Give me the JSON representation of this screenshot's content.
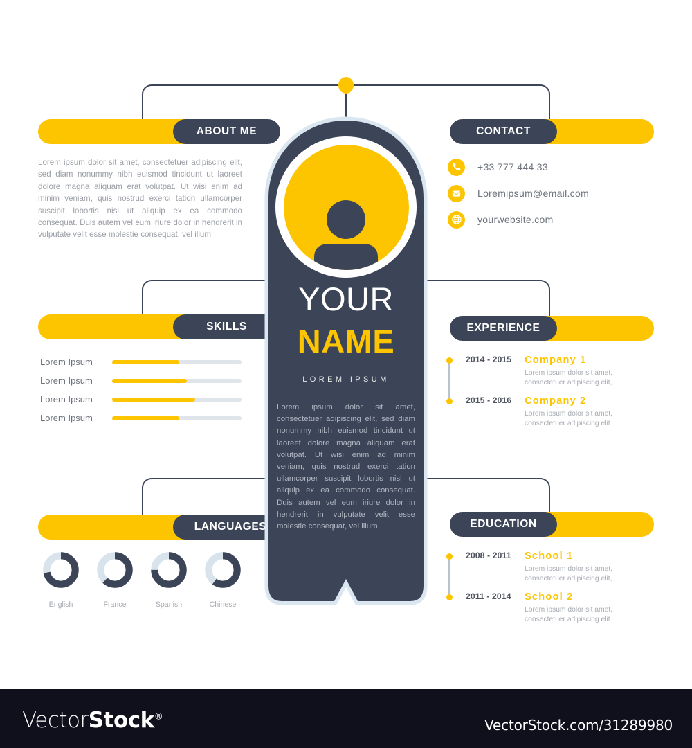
{
  "colors": {
    "yellow": "#fdc500",
    "navy": "#3c4558",
    "light_blue_gray": "#dfe5ea",
    "body_text": "#9b9fa6",
    "footer_bg": "#100f1c"
  },
  "profile": {
    "first_line": "YOUR",
    "second_line": "NAME",
    "subtitle": "LOREM IPSUM",
    "avatar_icon": "person-avatar-icon",
    "bio": "Lorem ipsum dolor sit amet, consectetuer adipiscing elit, sed diam nonummy nibh euismod tincidunt ut laoreet dolore magna aliquam erat volutpat. Ut wisi enim ad minim veniam, quis nostrud exerci tation ullamcorper suscipit lobortis nisl ut aliquip ex ea commodo consequat. Duis autem vel eum iriure dolor in hendrerit in vulputate velit esse molestie consequat, vel illum"
  },
  "about": {
    "title": "ABOUT ME",
    "text": "Lorem ipsum dolor sit amet, consectetuer adipiscing elit, sed diam nonummy nibh euismod tincidunt ut laoreet dolore magna aliquam erat volutpat. Ut wisi enim ad minim veniam, quis nostrud exerci tation ullamcorper suscipit lobortis nisl ut aliquip ex ea commodo consequat. Duis autem vel eum iriure dolor in hendrerit in vulputate velit esse molestie consequat, vel illum"
  },
  "contact": {
    "title": "CONTACT",
    "items": [
      {
        "icon": "phone-icon",
        "value": "+33 777 444 33"
      },
      {
        "icon": "envelope-icon",
        "value": "Loremipsum@email.com"
      },
      {
        "icon": "globe-icon",
        "value": "yourwebsite.com"
      }
    ]
  },
  "skills": {
    "title": "SKILLS",
    "items": [
      {
        "label": "Lorem Ipsum",
        "percent": 52
      },
      {
        "label": "Lorem Ipsum",
        "percent": 58
      },
      {
        "label": "Lorem Ipsum",
        "percent": 64
      },
      {
        "label": "Lorem Ipsum",
        "percent": 52
      }
    ]
  },
  "experience": {
    "title": "EXPERIENCE",
    "entries": [
      {
        "date": "2014 - 2015",
        "title": "Company 1",
        "desc": "Lorem ipsum dolor sit amet, consectetuer adipiscing elit,"
      },
      {
        "date": "2015 - 2016",
        "title": "Company 2",
        "desc": "Lorem ipsum dolor sit amet, consectetuer adipiscing elit"
      }
    ]
  },
  "education": {
    "title": "EDUCATION",
    "entries": [
      {
        "date": "2008 - 2011",
        "title": "School 1",
        "desc": "Lorem ipsum dolor sit amet, consectetuer adipiscing elit,"
      },
      {
        "date": "2011 - 2014",
        "title": "School 2",
        "desc": "Lorem ipsum dolor sit amet, consectetuer adipiscing elit"
      }
    ]
  },
  "languages": {
    "title": "LANGUAGES",
    "items": [
      {
        "label": "English",
        "percent": 72
      },
      {
        "label": "France",
        "percent": 62
      },
      {
        "label": "Spanish",
        "percent": 75
      },
      {
        "label": "Chinese",
        "percent": 60
      }
    ]
  },
  "footer": {
    "logo_light": "Vector",
    "logo_bold": "Stock",
    "logo_mark": "®",
    "url": "VectorStock.com/31289980"
  },
  "chart_data": [
    {
      "type": "bar",
      "title": "SKILLS",
      "orientation": "horizontal",
      "categories": [
        "Lorem Ipsum",
        "Lorem Ipsum",
        "Lorem Ipsum",
        "Lorem Ipsum"
      ],
      "values": [
        52,
        58,
        64,
        52
      ],
      "xlabel": "",
      "ylabel": "",
      "ylim": [
        0,
        100
      ],
      "grid": false,
      "legend": "none",
      "colors": {
        "fill": "#fdc500",
        "track": "#dfe5ea"
      }
    },
    {
      "type": "pie",
      "title": "LANGUAGES",
      "subtype": "donut",
      "categories": [
        "English",
        "France",
        "Spanish",
        "Chinese"
      ],
      "values": [
        72,
        62,
        75,
        60
      ],
      "grid": false,
      "legend": "below-each",
      "colors": {
        "fill": "#3c4558",
        "track": "#d8e3ec"
      }
    }
  ]
}
